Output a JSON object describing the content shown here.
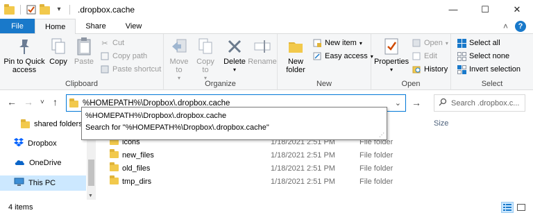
{
  "window": {
    "title": ".dropbox.cache",
    "controls": {
      "minimize": "—",
      "maximize": "☐",
      "close": "✕"
    }
  },
  "quick_access": {
    "dropdown": "▾"
  },
  "tabs": [
    {
      "label": "File"
    },
    {
      "label": "Home"
    },
    {
      "label": "Share"
    },
    {
      "label": "View"
    }
  ],
  "ribbon_extra": {
    "collapse": "˄",
    "help": "?"
  },
  "ribbon": {
    "clipboard": {
      "label": "Clipboard",
      "pin": "Pin to Quick access",
      "copy": "Copy",
      "paste": "Paste",
      "cut": "Cut",
      "copy_path": "Copy path",
      "paste_shortcut": "Paste shortcut"
    },
    "organize": {
      "label": "Organize",
      "move_to": "Move to",
      "copy_to": "Copy to",
      "delete": "Delete",
      "rename": "Rename"
    },
    "new": {
      "label": "New",
      "new_folder": "New folder",
      "new_item": "New item",
      "easy_access": "Easy access"
    },
    "open": {
      "label": "Open",
      "properties": "Properties",
      "open": "Open",
      "edit": "Edit",
      "history": "History"
    },
    "select": {
      "label": "Select",
      "select_all": "Select all",
      "select_none": "Select none",
      "invert_selection": "Invert selection"
    }
  },
  "address": {
    "value": "%HOMEPATH%\\Dropbox\\.dropbox.cache",
    "nav": {
      "back": "←",
      "forward": "→",
      "recent": "˅",
      "up": "↑",
      "go": "→"
    }
  },
  "search": {
    "placeholder": "Search .dropbox.c..."
  },
  "suggestions": [
    "%HOMEPATH%\\Dropbox\\.dropbox.cache",
    "Search for \"%HOMEPATH%\\Dropbox\\.dropbox.cache\""
  ],
  "navpane": {
    "items": [
      {
        "label": "shared folders",
        "icon": "folder-icon"
      },
      {
        "label": "Dropbox",
        "icon": "dropbox-icon"
      },
      {
        "label": "OneDrive",
        "icon": "onedrive-icon"
      },
      {
        "label": "This PC",
        "icon": "computer-icon",
        "selected": true
      }
    ]
  },
  "filelist": {
    "columns": {
      "size": "Size"
    },
    "rows": [
      {
        "name": "icons",
        "date": "1/18/2021 2:51 PM",
        "type": "File folder"
      },
      {
        "name": "new_files",
        "date": "1/18/2021 2:51 PM",
        "type": "File folder"
      },
      {
        "name": "old_files",
        "date": "1/18/2021 2:51 PM",
        "type": "File folder"
      },
      {
        "name": "tmp_dirs",
        "date": "1/18/2021 2:51 PM",
        "type": "File folder"
      }
    ]
  },
  "status": {
    "count": "4 items"
  },
  "colors": {
    "accent": "#1979ca",
    "folder": "#f2c94c",
    "selection": "#cce8ff"
  }
}
